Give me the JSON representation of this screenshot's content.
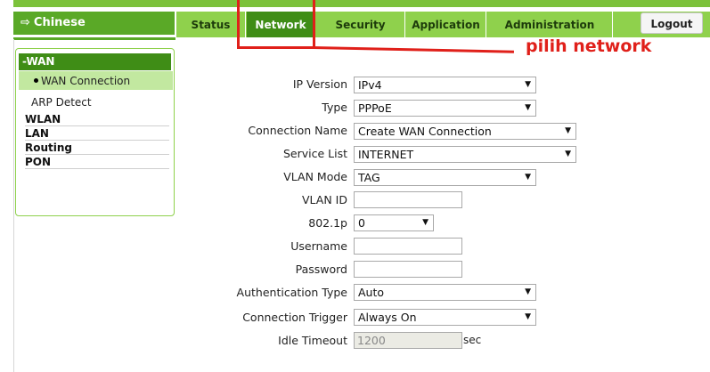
{
  "header": {
    "language_link": "Chinese",
    "logout_label": "Logout"
  },
  "tabs": [
    {
      "label": "Status"
    },
    {
      "label": "Network",
      "active": true
    },
    {
      "label": "Security"
    },
    {
      "label": "Application"
    },
    {
      "label": "Administration"
    }
  ],
  "annotation": {
    "text": "pilih network",
    "color": "#e0201a"
  },
  "sidebar": {
    "section": "-WAN",
    "active_item": "WAN Connection",
    "sub_item": "ARP Detect",
    "items": [
      "WLAN",
      "LAN",
      "Routing",
      "PON"
    ]
  },
  "form": {
    "ip_version": {
      "label": "IP Version",
      "value": "IPv4"
    },
    "type": {
      "label": "Type",
      "value": "PPPoE"
    },
    "connection_name": {
      "label": "Connection Name",
      "value": "Create WAN Connection"
    },
    "service_list": {
      "label": "Service List",
      "value": "INTERNET"
    },
    "vlan_mode": {
      "label": "VLAN Mode",
      "value": "TAG"
    },
    "vlan_id": {
      "label": "VLAN ID",
      "value": ""
    },
    "dot1p": {
      "label": "802.1p",
      "value": "0"
    },
    "username": {
      "label": "Username",
      "value": ""
    },
    "password": {
      "label": "Password",
      "value": ""
    },
    "auth_type": {
      "label": "Authentication Type",
      "value": "Auto"
    },
    "conn_trigger": {
      "label": "Connection Trigger",
      "value": "Always On"
    },
    "idle_timeout": {
      "label": "Idle Timeout",
      "value": "1200",
      "unit": "sec"
    }
  },
  "colors": {
    "brand_green": "#5aa927",
    "tab_green": "#8fd14c",
    "active_tab": "#3f8d16"
  }
}
